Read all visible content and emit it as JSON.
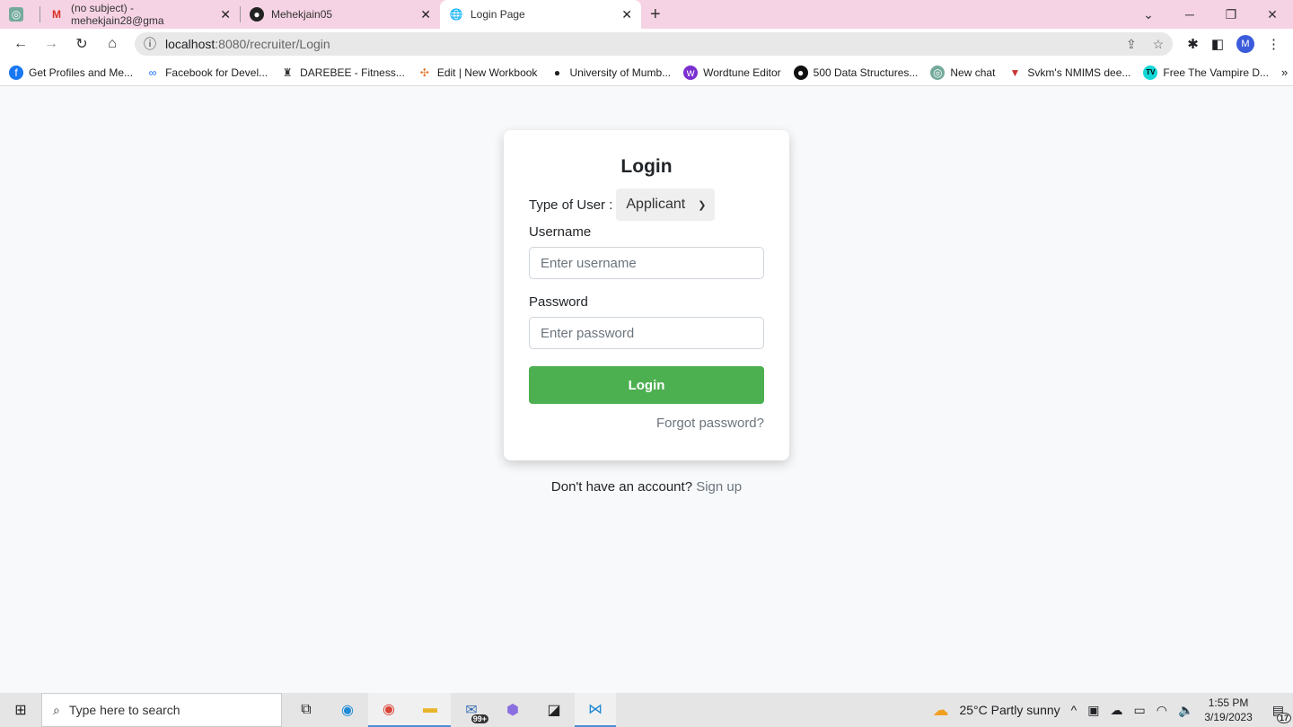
{
  "browser": {
    "tabs": [
      {
        "icon": "chatgpt-icon",
        "title": ""
      },
      {
        "icon": "gmail-icon",
        "title": "(no subject) - mehekjain28@gma"
      },
      {
        "icon": "github-icon",
        "title": "Mehekjain05"
      },
      {
        "icon": "globe-icon",
        "title": "Login Page",
        "active": true
      }
    ],
    "url_host": "localhost",
    "url_path": ":8080/recruiter/Login",
    "profile_initial": "M",
    "bookmarks": [
      "Get Profiles and Me...",
      "Facebook for Devel...",
      "DAREBEE - Fitness...",
      "Edit | New Workbook",
      "University of Mumb...",
      "Wordtune Editor",
      "500 Data Structures...",
      "New chat",
      "Svkm's NMIMS dee...",
      "Free The Vampire D..."
    ],
    "more": "»"
  },
  "login": {
    "title": "Login",
    "user_type_label": "Type of User :",
    "user_type_value": "Applicant",
    "username_label": "Username",
    "username_placeholder": "Enter username",
    "password_label": "Password",
    "password_placeholder": "Enter password",
    "submit": "Login",
    "forgot": "Forgot password?",
    "no_account": "Don't have an account?",
    "signup": "Sign up",
    "button_color": "#4caf50"
  },
  "taskbar": {
    "search_placeholder": "Type here to search",
    "weather": "25°C  Partly sunny",
    "time": "1:55 PM",
    "date": "3/19/2023",
    "notifications": "17",
    "mail_badge": "99+"
  }
}
